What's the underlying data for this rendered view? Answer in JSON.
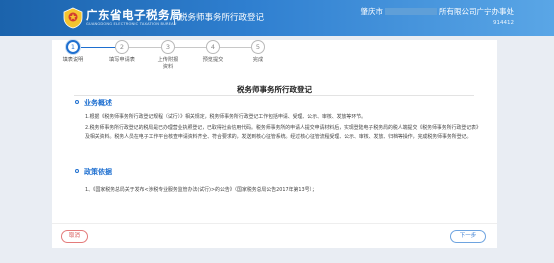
{
  "header": {
    "brand": "广东省电子税务局",
    "brand_en": "GUANGDONG ELECTRONIC TAXATION BUREAU",
    "subtitle": "税务师事务所行政登记",
    "org_left": "肇庆市",
    "org_right": "所有限公司广宁办事处",
    "tax_id": "914412",
    "colors": {
      "header_start": "#1b63ac",
      "header_end": "#5aa6e6",
      "logo": "emblem-icon"
    }
  },
  "steps": [
    {
      "number": "1",
      "label": "填表说明",
      "active": true
    },
    {
      "number": "2",
      "label": "填写申请表",
      "active": false
    },
    {
      "number": "3",
      "label": "上传附报资料",
      "active": false
    },
    {
      "number": "4",
      "label": "预览提交",
      "active": false
    },
    {
      "number": "5",
      "label": "完成",
      "active": false
    }
  ],
  "content": {
    "title": "税务师事务所行政登记",
    "overview_heading": "业务概述",
    "overview_p1": "1.根据《税务师事务所行政登记规程（试行）》相关规定，税务师事务所行政登记工作包括申请、受理、公示、审核、发放等环节。",
    "overview_p2": "2.税务师事务所行政登记的税局是已办理营业执照登记，已取得社会信用代码。税务师事务所的申请人提交申请材料后，实现登陆电子税务局的税人端提交《税务师事务所行政登记表》及相关资料。税务人员在电子工作平台核查申请资料齐全、符合要求的，发送到核心征管系统。经过核心征管流程受理、公示、审核、发放、归档等操作，完成税务师事务所登记。",
    "policy_heading": "政策依据",
    "policy_item": "1、《国家税务总局关于发布<涉税专业服务监管办法(试行)>的公告》（国家税务总局公告2017年第13号）；"
  },
  "footer": {
    "cancel_label": "取消",
    "next_label": "下一步"
  }
}
